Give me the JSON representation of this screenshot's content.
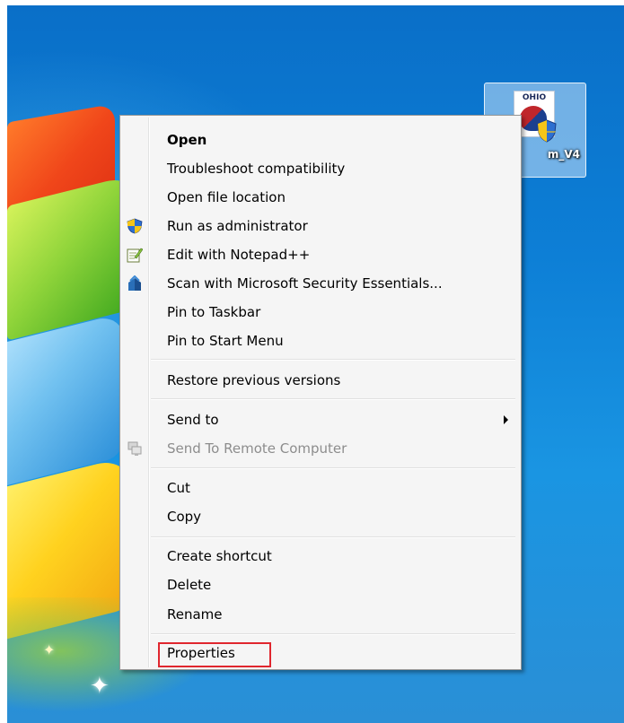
{
  "desktop": {
    "icon": {
      "label": "m_V4",
      "logo_text": "OHIO"
    }
  },
  "context_menu": {
    "items": [
      {
        "label": "Open",
        "bold": true,
        "icon": null
      },
      {
        "label": "Troubleshoot compatibility",
        "icon": null
      },
      {
        "label": "Open file location",
        "icon": null
      },
      {
        "label": "Run as administrator",
        "icon": "uac-shield-icon"
      },
      {
        "label": "Edit with Notepad++",
        "icon": "notepad-plus-plus-icon"
      },
      {
        "label": "Scan with Microsoft Security Essentials...",
        "icon": "security-essentials-icon"
      },
      {
        "label": "Pin to Taskbar",
        "icon": null
      },
      {
        "label": "Pin to Start Menu",
        "icon": null
      },
      {
        "label": "Restore previous versions",
        "icon": null
      },
      {
        "label": "Send to",
        "icon": null,
        "submenu": true
      },
      {
        "label": "Send To Remote Computer",
        "icon": "remote-computer-icon",
        "disabled": true
      },
      {
        "label": "Cut",
        "icon": null
      },
      {
        "label": "Copy",
        "icon": null
      },
      {
        "label": "Create shortcut",
        "icon": null
      },
      {
        "label": "Delete",
        "icon": null
      },
      {
        "label": "Rename",
        "icon": null
      },
      {
        "label": "Properties",
        "icon": null,
        "highlighted": true
      }
    ],
    "highlight_color": "#e0262e"
  }
}
